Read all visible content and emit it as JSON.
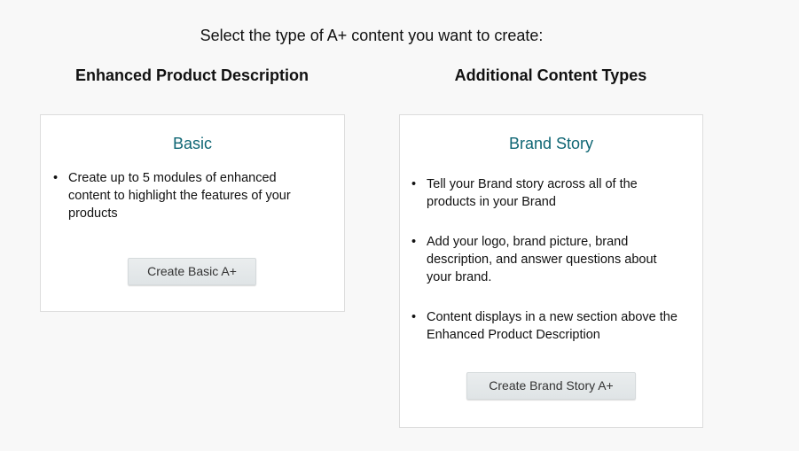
{
  "page": {
    "title": "Select the type of A+ content you want to create:"
  },
  "sections": {
    "left_heading": "Enhanced Product Description",
    "right_heading": "Additional Content Types"
  },
  "basic_card": {
    "title": "Basic",
    "bullets": [
      "Create up to 5 modules of enhanced content to highlight the features of your products"
    ],
    "button_label": "Create Basic A+"
  },
  "brand_card": {
    "title": "Brand Story",
    "bullets": [
      "Tell your Brand story across all of the products in your Brand",
      "Add your logo, brand picture, brand description, and answer questions about your brand.",
      "Content displays in a new section above the Enhanced Product Description"
    ],
    "button_label": "Create Brand Story A+"
  },
  "colors": {
    "card_title": "#0f6674",
    "page_background": "#f8f8f8",
    "button_background": "#e3e8ea"
  }
}
